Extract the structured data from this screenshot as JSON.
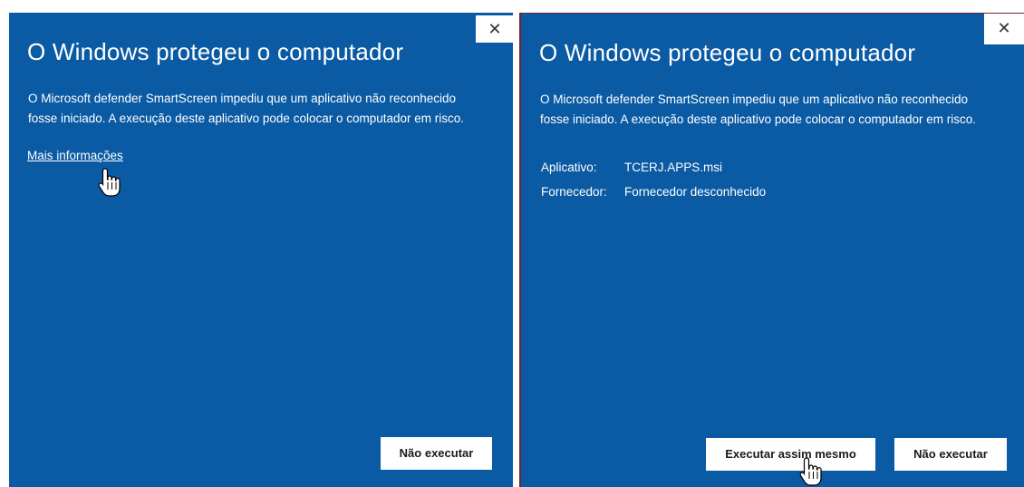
{
  "left_dialog": {
    "close_glyph": "✕",
    "title": "O Windows protegeu o computador",
    "message": "O Microsoft defender SmartScreen impediu que um aplicativo não reconhecido fosse iniciado. A execução deste aplicativo pode colocar o computador em risco.",
    "more_info_link": "Mais informações",
    "dont_run_label": "Não executar"
  },
  "right_dialog": {
    "close_glyph": "✕",
    "title": "O Windows protegeu o computador",
    "message": "O Microsoft defender SmartScreen impediu que um aplicativo não reconhecido fosse iniciado. A execução deste aplicativo pode colocar o computador em risco.",
    "app_key": "Aplicativo:",
    "app_value": "TCERJ.APPS.msi",
    "publisher_key": "Fornecedor:",
    "publisher_value": "Fornecedor desconhecido",
    "run_anyway_label": "Executar assim mesmo",
    "dont_run_label": "Não executar"
  },
  "colors": {
    "panel_bg": "#0a5aa4",
    "panel_border": "#7a1f2a",
    "button_bg": "#ffffff"
  },
  "icons": [
    "close-icon",
    "hand-cursor-icon"
  ]
}
